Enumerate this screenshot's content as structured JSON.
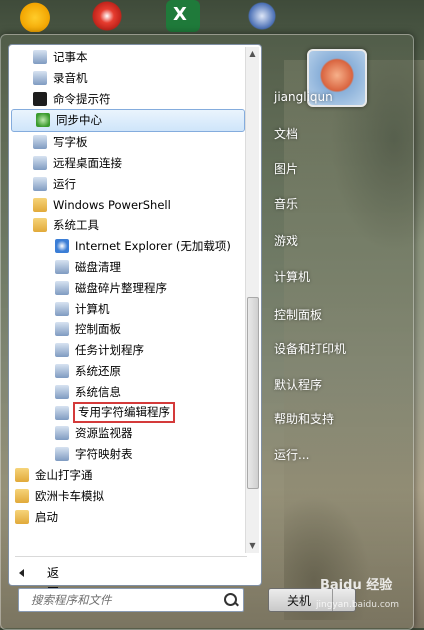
{
  "left_panel": {
    "items": [
      {
        "label": "记事本",
        "icon": "notepad-icon",
        "level": 1
      },
      {
        "label": "录音机",
        "icon": "microphone-icon",
        "level": 1
      },
      {
        "label": "命令提示符",
        "icon": "cmd-icon",
        "level": 1
      },
      {
        "label": "同步中心",
        "icon": "sync-icon",
        "level": 1,
        "selected": true
      },
      {
        "label": "写字板",
        "icon": "wordpad-icon",
        "level": 1
      },
      {
        "label": "远程桌面连接",
        "icon": "remote-desktop-icon",
        "level": 1
      },
      {
        "label": "运行",
        "icon": "run-icon",
        "level": 1
      },
      {
        "label": "Windows PowerShell",
        "icon": "folder-icon",
        "level": 1
      },
      {
        "label": "系统工具",
        "icon": "folder-icon",
        "level": 1
      },
      {
        "label": "Internet Explorer (无加载项)",
        "icon": "ie-icon",
        "level": 2
      },
      {
        "label": "磁盘清理",
        "icon": "disk-cleanup-icon",
        "level": 2
      },
      {
        "label": "磁盘碎片整理程序",
        "icon": "defrag-icon",
        "level": 2
      },
      {
        "label": "计算机",
        "icon": "computer-icon",
        "level": 2
      },
      {
        "label": "控制面板",
        "icon": "control-panel-icon",
        "level": 2
      },
      {
        "label": "任务计划程序",
        "icon": "clock-icon",
        "level": 2
      },
      {
        "label": "系统还原",
        "icon": "restore-icon",
        "level": 2
      },
      {
        "label": "系统信息",
        "icon": "sysinfo-icon",
        "level": 2
      },
      {
        "label": "专用字符编辑程序",
        "icon": "char-editor-icon",
        "level": 2,
        "boxed": true
      },
      {
        "label": "资源监视器",
        "icon": "resource-monitor-icon",
        "level": 2
      },
      {
        "label": "字符映射表",
        "icon": "charmap-icon",
        "level": 2
      },
      {
        "label": "金山打字通",
        "icon": "folder-icon",
        "level": 0
      },
      {
        "label": "欧洲卡车模拟",
        "icon": "folder-icon",
        "level": 0
      },
      {
        "label": "启动",
        "icon": "folder-icon",
        "level": 0
      }
    ],
    "back_label": "返回",
    "search_placeholder": "搜索程序和文件"
  },
  "right_panel": {
    "items": [
      "jiangliqun",
      "文档",
      "图片",
      "音乐",
      "游戏",
      "计算机",
      "控制面板",
      "设备和打印机",
      "默认程序",
      "帮助和支持",
      "运行..."
    ],
    "shutdown_label": "关机"
  },
  "watermark": {
    "text": "Baidu 经验",
    "url_text": "jingyan.baidu.com"
  },
  "colors": {
    "selection": "#cfe5fa",
    "highlight_box": "#d43a3a"
  }
}
